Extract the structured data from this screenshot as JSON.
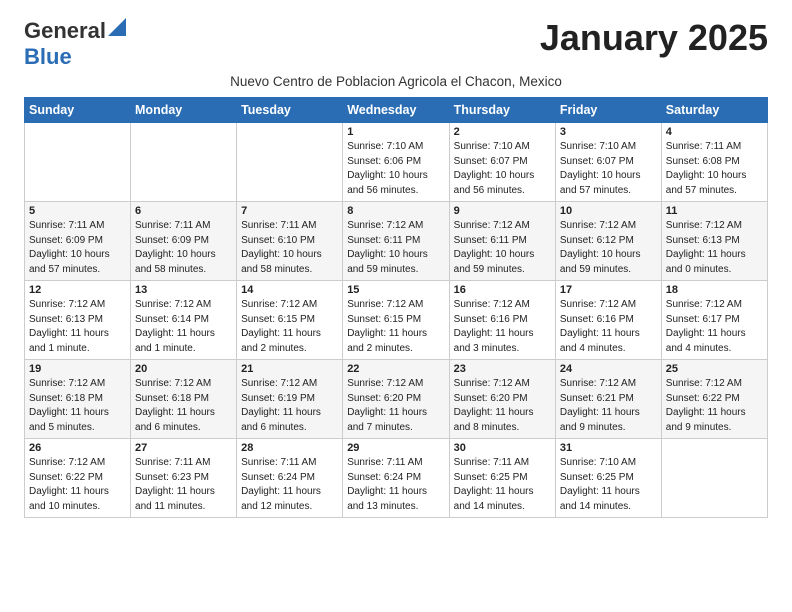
{
  "header": {
    "logo_general": "General",
    "logo_blue": "Blue",
    "month_title": "January 2025",
    "subtitle": "Nuevo Centro de Poblacion Agricola el Chacon, Mexico"
  },
  "days_of_week": [
    "Sunday",
    "Monday",
    "Tuesday",
    "Wednesday",
    "Thursday",
    "Friday",
    "Saturday"
  ],
  "weeks": [
    [
      {
        "day": "",
        "info": ""
      },
      {
        "day": "",
        "info": ""
      },
      {
        "day": "",
        "info": ""
      },
      {
        "day": "1",
        "info": "Sunrise: 7:10 AM\nSunset: 6:06 PM\nDaylight: 10 hours\nand 56 minutes."
      },
      {
        "day": "2",
        "info": "Sunrise: 7:10 AM\nSunset: 6:07 PM\nDaylight: 10 hours\nand 56 minutes."
      },
      {
        "day": "3",
        "info": "Sunrise: 7:10 AM\nSunset: 6:07 PM\nDaylight: 10 hours\nand 57 minutes."
      },
      {
        "day": "4",
        "info": "Sunrise: 7:11 AM\nSunset: 6:08 PM\nDaylight: 10 hours\nand 57 minutes."
      }
    ],
    [
      {
        "day": "5",
        "info": "Sunrise: 7:11 AM\nSunset: 6:09 PM\nDaylight: 10 hours\nand 57 minutes."
      },
      {
        "day": "6",
        "info": "Sunrise: 7:11 AM\nSunset: 6:09 PM\nDaylight: 10 hours\nand 58 minutes."
      },
      {
        "day": "7",
        "info": "Sunrise: 7:11 AM\nSunset: 6:10 PM\nDaylight: 10 hours\nand 58 minutes."
      },
      {
        "day": "8",
        "info": "Sunrise: 7:12 AM\nSunset: 6:11 PM\nDaylight: 10 hours\nand 59 minutes."
      },
      {
        "day": "9",
        "info": "Sunrise: 7:12 AM\nSunset: 6:11 PM\nDaylight: 10 hours\nand 59 minutes."
      },
      {
        "day": "10",
        "info": "Sunrise: 7:12 AM\nSunset: 6:12 PM\nDaylight: 10 hours\nand 59 minutes."
      },
      {
        "day": "11",
        "info": "Sunrise: 7:12 AM\nSunset: 6:13 PM\nDaylight: 11 hours\nand 0 minutes."
      }
    ],
    [
      {
        "day": "12",
        "info": "Sunrise: 7:12 AM\nSunset: 6:13 PM\nDaylight: 11 hours\nand 1 minute."
      },
      {
        "day": "13",
        "info": "Sunrise: 7:12 AM\nSunset: 6:14 PM\nDaylight: 11 hours\nand 1 minute."
      },
      {
        "day": "14",
        "info": "Sunrise: 7:12 AM\nSunset: 6:15 PM\nDaylight: 11 hours\nand 2 minutes."
      },
      {
        "day": "15",
        "info": "Sunrise: 7:12 AM\nSunset: 6:15 PM\nDaylight: 11 hours\nand 2 minutes."
      },
      {
        "day": "16",
        "info": "Sunrise: 7:12 AM\nSunset: 6:16 PM\nDaylight: 11 hours\nand 3 minutes."
      },
      {
        "day": "17",
        "info": "Sunrise: 7:12 AM\nSunset: 6:16 PM\nDaylight: 11 hours\nand 4 minutes."
      },
      {
        "day": "18",
        "info": "Sunrise: 7:12 AM\nSunset: 6:17 PM\nDaylight: 11 hours\nand 4 minutes."
      }
    ],
    [
      {
        "day": "19",
        "info": "Sunrise: 7:12 AM\nSunset: 6:18 PM\nDaylight: 11 hours\nand 5 minutes."
      },
      {
        "day": "20",
        "info": "Sunrise: 7:12 AM\nSunset: 6:18 PM\nDaylight: 11 hours\nand 6 minutes."
      },
      {
        "day": "21",
        "info": "Sunrise: 7:12 AM\nSunset: 6:19 PM\nDaylight: 11 hours\nand 6 minutes."
      },
      {
        "day": "22",
        "info": "Sunrise: 7:12 AM\nSunset: 6:20 PM\nDaylight: 11 hours\nand 7 minutes."
      },
      {
        "day": "23",
        "info": "Sunrise: 7:12 AM\nSunset: 6:20 PM\nDaylight: 11 hours\nand 8 minutes."
      },
      {
        "day": "24",
        "info": "Sunrise: 7:12 AM\nSunset: 6:21 PM\nDaylight: 11 hours\nand 9 minutes."
      },
      {
        "day": "25",
        "info": "Sunrise: 7:12 AM\nSunset: 6:22 PM\nDaylight: 11 hours\nand 9 minutes."
      }
    ],
    [
      {
        "day": "26",
        "info": "Sunrise: 7:12 AM\nSunset: 6:22 PM\nDaylight: 11 hours\nand 10 minutes."
      },
      {
        "day": "27",
        "info": "Sunrise: 7:11 AM\nSunset: 6:23 PM\nDaylight: 11 hours\nand 11 minutes."
      },
      {
        "day": "28",
        "info": "Sunrise: 7:11 AM\nSunset: 6:24 PM\nDaylight: 11 hours\nand 12 minutes."
      },
      {
        "day": "29",
        "info": "Sunrise: 7:11 AM\nSunset: 6:24 PM\nDaylight: 11 hours\nand 13 minutes."
      },
      {
        "day": "30",
        "info": "Sunrise: 7:11 AM\nSunset: 6:25 PM\nDaylight: 11 hours\nand 14 minutes."
      },
      {
        "day": "31",
        "info": "Sunrise: 7:10 AM\nSunset: 6:25 PM\nDaylight: 11 hours\nand 14 minutes."
      },
      {
        "day": "",
        "info": ""
      }
    ]
  ]
}
